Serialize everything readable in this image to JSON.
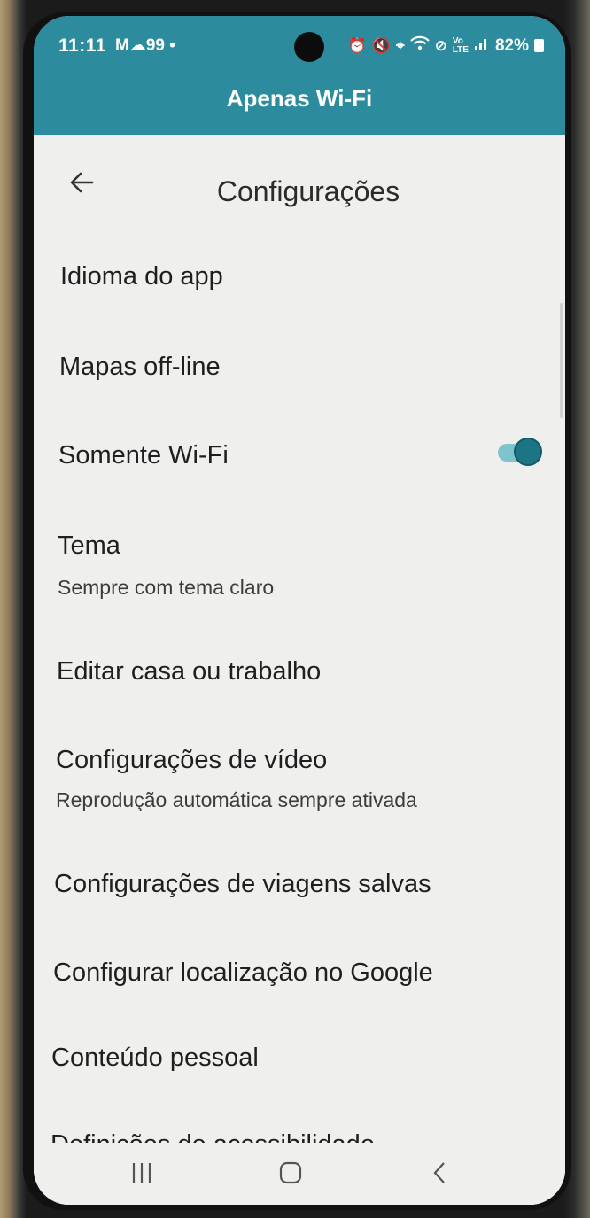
{
  "status_bar": {
    "time": "11:11",
    "left_icons": "M☁99 •",
    "battery": "82%",
    "icons": [
      "alarm-icon",
      "mute-icon",
      "location-icon",
      "wifi-icon",
      "block-icon",
      "volte-icon",
      "signal-icon",
      "battery-icon"
    ]
  },
  "banner": {
    "title": "Apenas Wi-Fi",
    "color": "#2c8c9e"
  },
  "header": {
    "title": "Configurações",
    "back_icon": "arrow-left-icon"
  },
  "settings": [
    {
      "label": "Idioma do app"
    },
    {
      "label": "Mapas off-line"
    },
    {
      "label": "Somente Wi-Fi",
      "toggle": true
    },
    {
      "label": "Tema",
      "subtitle": "Sempre com tema claro"
    },
    {
      "label": "Editar casa ou trabalho"
    },
    {
      "label": "Configurações de vídeo",
      "subtitle": "Reprodução automática sempre ativada"
    },
    {
      "label": "Configurações de viagens salvas"
    },
    {
      "label": "Configurar localização no Google"
    },
    {
      "label": "Conteúdo pessoal"
    },
    {
      "label": "Definições de acessibilidade"
    }
  ],
  "nav_bar": {
    "buttons": [
      "recent-apps-icon",
      "home-icon",
      "back-icon"
    ]
  },
  "colors": {
    "accent": "#1c7585",
    "toggle_track": "#7fc3cd",
    "background": "#efefed"
  }
}
